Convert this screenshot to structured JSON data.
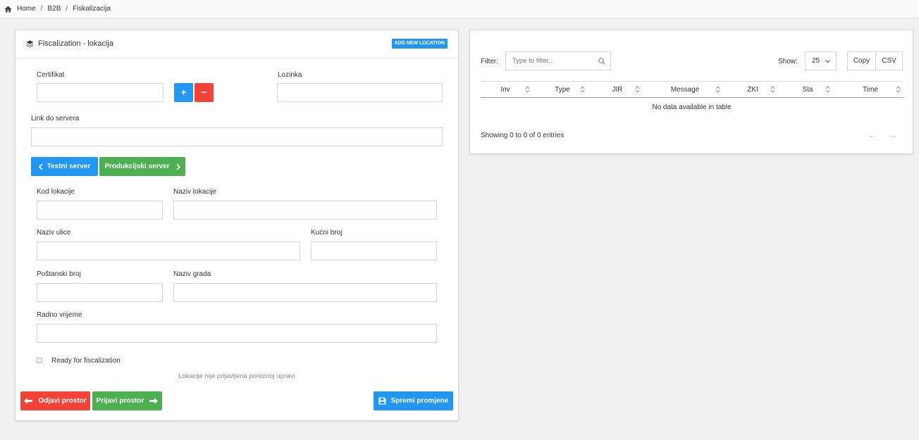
{
  "breadcrumb": {
    "items": [
      "Home",
      "B2B",
      "Fiskalizacija"
    ],
    "separator": "/"
  },
  "form": {
    "title": "Fiscalization - lokacija",
    "add_button": "ADD NEW LOCATION",
    "certifikat_label": "Certifikat",
    "certifikat_value": "",
    "plus_label": "+",
    "minus_label": "−",
    "lozinka_label": "Lozinka",
    "lozinka_value": "",
    "link_label": "Link do servera",
    "link_value": "",
    "test_server_label": "Testni server",
    "prod_server_label": "Produkcijski server",
    "kod_label": "Kod lokacije",
    "kod_value": "",
    "naziv_lok_label": "Naziv lokacije",
    "naziv_lok_value": "",
    "ulica_label": "Naziv ulice",
    "ulica_value": "",
    "kucni_label": "Kućni broj",
    "kucni_value": "",
    "postanski_label": "Poštanski broj",
    "postanski_value": "",
    "grad_label": "Naziv grada",
    "grad_value": "",
    "radno_label": "Radno vrijeme",
    "radno_value": "",
    "ready_label": "Ready for fiscalization",
    "ready_checked": false,
    "status_note": "Lokacije nije prijavljena poreznoj upravi",
    "odjavi_label": "Odjavi prostor",
    "prijavi_label": "Prijavi prostor",
    "spremi_label": "Spremi promjene"
  },
  "table": {
    "filter_label": "Filter:",
    "filter_placeholder": "Type to filter...",
    "show_label": "Show:",
    "page_size": "25",
    "copy_label": "Copy",
    "csv_label": "CSV",
    "columns": [
      "Inv",
      "Type",
      "JIR",
      "Message",
      "ZKI",
      "Sta",
      "Time"
    ],
    "empty_text": "No data available in table",
    "info_text": "Showing 0 to 0 of 0 entries",
    "prev_arrow": "←",
    "next_arrow": "→"
  },
  "colors": {
    "primary": "#2196f3",
    "danger": "#f44336",
    "success": "#4caf50"
  }
}
